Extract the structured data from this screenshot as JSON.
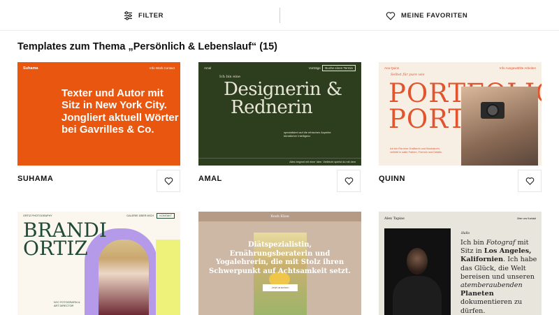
{
  "topbar": {
    "filter_label": "FILTER",
    "favorites_label": "MEINE FAVORITEN"
  },
  "heading": "Templates zum Thema „Persönlich & Lebenslauf“ (15)",
  "cards": [
    {
      "name": "SUHAMA",
      "preview": {
        "brand": "Suhama",
        "nav": "Info   Work   Contact",
        "headline": "Texter und Autor mit Sitz in New York City. Jongliert aktuell Wörter bei Gavrilles & Co."
      }
    },
    {
      "name": "AMAL",
      "preview": {
        "brand": "Amal",
        "nav_button": "Buche einen Termin",
        "nav_link": "Vorträge",
        "intro": "Ich bin eine",
        "line1": "Designerin &",
        "line2": "Rednerin",
        "small": "spezialisiert auf die ethischen Aspekte künstlicher Intelligenz",
        "footer": "Alles beginnt mit einer Idee. Vielleicht spielst du mit dem"
      }
    },
    {
      "name": "QUINN",
      "preview": {
        "brand": "Ana Quinn",
        "nav": "Info   Ausgewählte Arbeiten",
        "tagline": "Selbst für pure wie",
        "big1": "PORTFOLIO",
        "big2": "PORTF",
        "text": "Ich bin Ria eine Grafikerin und Illustratorin, verliebt in satte Farben, Formen und Details."
      }
    },
    {
      "name": "",
      "preview": {
        "brand": "ORTIZ PHOTOGRAPHY",
        "nav": "GALERIE   ÜBER MICH",
        "nav_button": "KONTAKT",
        "big1": "BRANDI",
        "big2": "ORTIZ",
        "text": "NYC FOTOGRAFIN & ART DIRECTOR"
      }
    },
    {
      "name": "",
      "preview": {
        "brand": "Rosh Elise",
        "headline": "Diätspezialistin, Ernährungsberaterin und Yogalehrerin, die mit Stolz ihren Schwerpunkt auf Achtsamkeit setzt.",
        "button": "Jetzt ansehen"
      }
    },
    {
      "name": "",
      "preview": {
        "brand": "Alex Tapias",
        "nav": "Über uns   Kontakt",
        "greeting": "Hallo",
        "t1": "Ich bin ",
        "t2": "Fotograf",
        "t3": " mit Sitz in ",
        "t4": "Los Angeles, Kalifornien",
        "t5": ". Ich habe das Glück, die Welt bereisen und unseren ",
        "t6": "atemberaubenden",
        "t7": " ",
        "t8": "Planeten",
        "t9": " dokumentieren zu dürfen."
      }
    }
  ],
  "colors": {
    "suhama_bg": "#e9560f",
    "amal_bg": "#2d3e1f",
    "quinn_accent": "#e2542e",
    "brandi_green": "#1f4a33",
    "rosh_bg": "#cdb8a5",
    "alex_bg": "#e8e5dc"
  }
}
